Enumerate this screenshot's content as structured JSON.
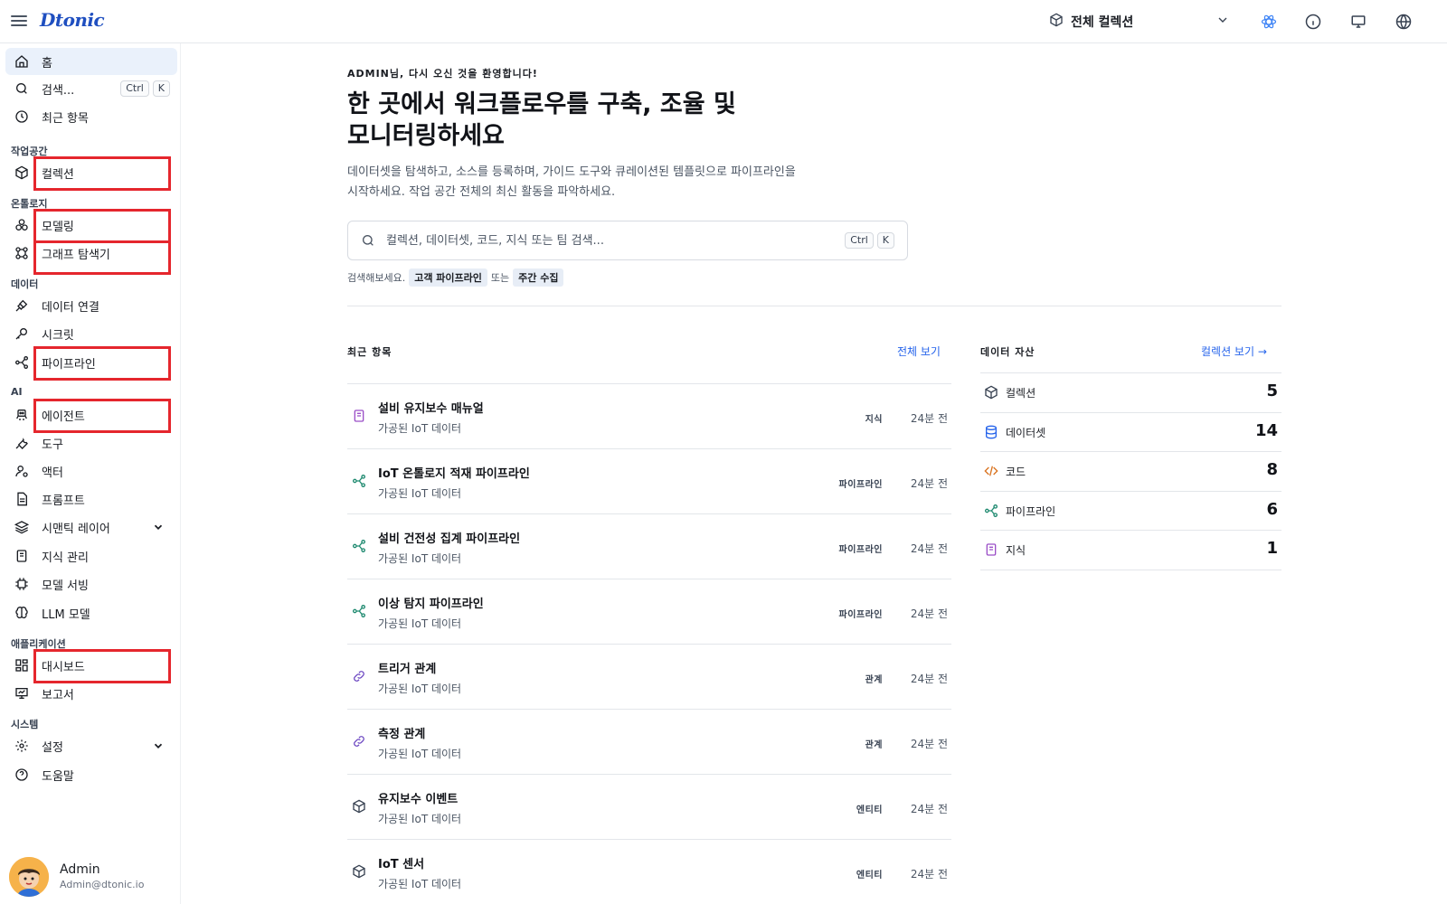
{
  "header": {
    "logo": "Dtonic",
    "collection_select": "전체 컬렉션"
  },
  "sidebar": {
    "home": "홈",
    "search": "검색...",
    "search_kbd": [
      "Ctrl",
      "K"
    ],
    "recent": "최근 항목",
    "sections": {
      "workspace": "작업공간",
      "ontology": "온톨로지",
      "data": "데이터",
      "ai": "AI",
      "applications": "애플리케이션",
      "system": "시스템"
    },
    "items": {
      "collection": "컬렉션",
      "modeling": "모델링",
      "graph_explorer": "그래프 탐색기",
      "data_connection": "데이터 연결",
      "secret": "시크릿",
      "pipeline": "파이프라인",
      "agent": "에이전트",
      "tool": "도구",
      "actor": "액터",
      "prompt": "프롬프트",
      "semantic_layer": "시맨틱 레이어",
      "knowledge": "지식 관리",
      "model_serving": "모델 서빙",
      "llm_model": "LLM 모델",
      "dashboard": "대시보드",
      "report": "보고서",
      "settings": "설정",
      "help": "도움말"
    },
    "profile": {
      "name": "Admin",
      "email": "Admin@dtonic.io"
    }
  },
  "main": {
    "welcome": "ADMIN님, 다시 오신 것을 환영합니다!",
    "hero_line1": "한 곳에서 워크플로우를 구축, 조율 및",
    "hero_line2": "모니터링하세요",
    "desc_line1": "데이터셋을 탐색하고, 소스를 등록하며, 가이드 도구와 큐레이션된 템플릿으로 파이프라인을",
    "desc_line2": "시작하세요. 작업 공간 전체의 최신 활동을 파악하세요.",
    "search_placeholder": "컬렉션, 데이터셋, 코드, 지식 또는 팀 검색...",
    "search_kbd": [
      "Ctrl",
      "K"
    ],
    "suggest_prefix": "검색해보세요.",
    "suggest_chip1": "고객 파이프라인",
    "suggest_or": "또는",
    "suggest_chip2": "주간 수집"
  },
  "recent": {
    "title": "최근 항목",
    "view_all": "전체 보기",
    "items": [
      {
        "icon": "book-icon",
        "title": "설비 유지보수 매뉴얼",
        "sub": "가공된 IoT 데이터",
        "type": "지식",
        "time": "24분 전"
      },
      {
        "icon": "pipeline-icon",
        "title": "IoT 온톨로지 적재 파이프라인",
        "sub": "가공된 IoT 데이터",
        "type": "파이프라인",
        "time": "24분 전"
      },
      {
        "icon": "pipeline-icon",
        "title": "설비 건전성 집계 파이프라인",
        "sub": "가공된 IoT 데이터",
        "type": "파이프라인",
        "time": "24분 전"
      },
      {
        "icon": "pipeline-icon",
        "title": "이상 탐지 파이프라인",
        "sub": "가공된 IoT 데이터",
        "type": "파이프라인",
        "time": "24분 전"
      },
      {
        "icon": "link-icon",
        "title": "트리거 관계",
        "sub": "가공된 IoT 데이터",
        "type": "관계",
        "time": "24분 전"
      },
      {
        "icon": "link-icon",
        "title": "측정 관계",
        "sub": "가공된 IoT 데이터",
        "type": "관계",
        "time": "24분 전"
      },
      {
        "icon": "cube-icon",
        "title": "유지보수 이벤트",
        "sub": "가공된 IoT 데이터",
        "type": "엔티티",
        "time": "24분 전"
      },
      {
        "icon": "cube-icon",
        "title": "IoT 센서",
        "sub": "가공된 IoT 데이터",
        "type": "엔티티",
        "time": "24분 전"
      }
    ]
  },
  "assets": {
    "title": "데이터 자산",
    "link": "컬렉션 보기 →",
    "items": [
      {
        "icon": "cube-icon",
        "label": "컬렉션",
        "value": "5"
      },
      {
        "icon": "database-icon",
        "label": "데이터셋",
        "value": "14"
      },
      {
        "icon": "code-icon",
        "label": "코드",
        "value": "8"
      },
      {
        "icon": "pipeline-icon",
        "label": "파이프라인",
        "value": "6"
      },
      {
        "icon": "book-icon",
        "label": "지식",
        "value": "1"
      }
    ]
  },
  "colors": {
    "accent": "#2563eb",
    "highlight_box": "#e5262d",
    "pipeline_icon": "#1f8a70",
    "book_icon": "#9b4fc7",
    "link_icon": "#6b46c1",
    "code_icon": "#d9731f"
  }
}
